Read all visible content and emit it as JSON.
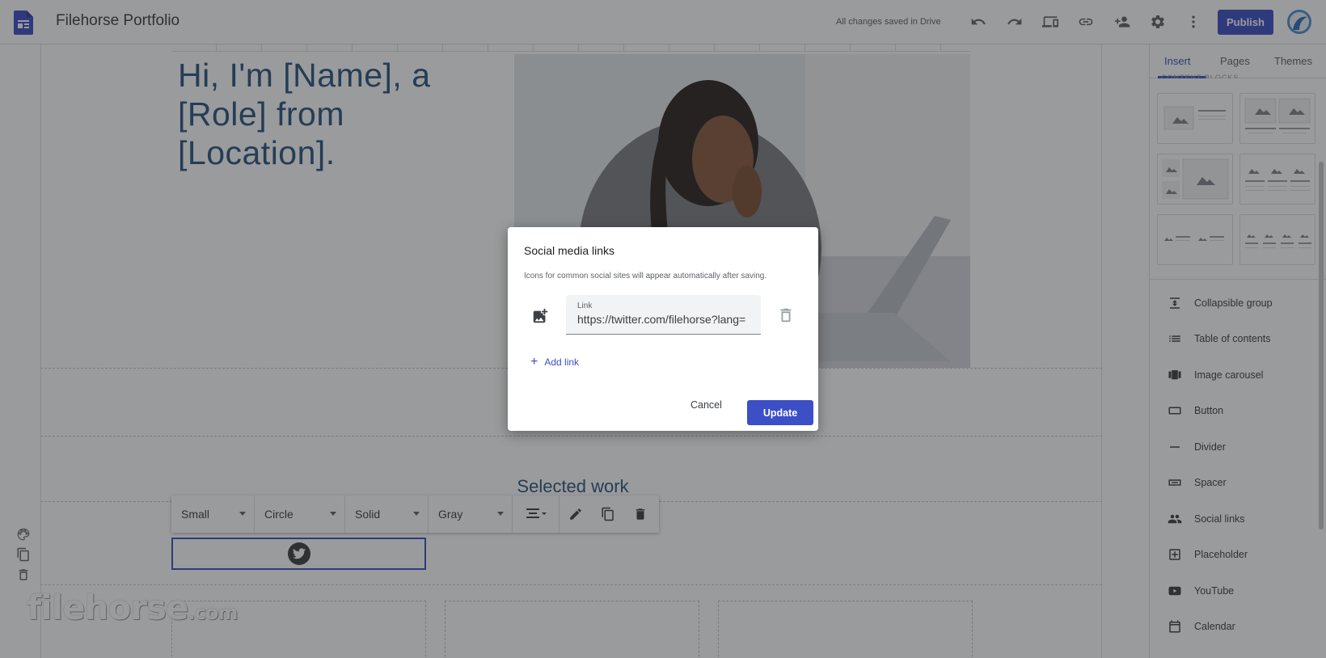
{
  "header": {
    "app_icon": "google-sites-icon",
    "title": "Filehorse Portfolio",
    "save_status": "All changes saved in Drive",
    "toolbar_icons": [
      "undo-icon",
      "redo-icon",
      "preview-icon",
      "link-icon",
      "share-icon",
      "settings-icon",
      "more-vert-icon"
    ],
    "publish_label": "Publish"
  },
  "page": {
    "hero_title": "Hi, I'm [Name], a [Role] from [Location].",
    "section_heading": "Selected work"
  },
  "element_toolbar": {
    "size": "Small",
    "shape": "Circle",
    "style": "Solid",
    "color": "Gray",
    "icons": [
      "align-center-icon",
      "edit-icon",
      "duplicate-icon",
      "delete-icon"
    ]
  },
  "left_tools": [
    "theme-palette-icon",
    "copy-icon",
    "trash-icon"
  ],
  "watermark": {
    "main": "filehorse",
    "suffix": ".com"
  },
  "side_panel": {
    "tabs": [
      "Insert",
      "Pages",
      "Themes"
    ],
    "active_tab": "Insert",
    "blocks_label": "CONTENT BLOCKS",
    "insert_items": [
      {
        "label": "Collapsible group",
        "icon": "collapsible-icon"
      },
      {
        "label": "Table of contents",
        "icon": "toc-icon"
      },
      {
        "label": "Image carousel",
        "icon": "carousel-icon"
      },
      {
        "label": "Button",
        "icon": "button-icon"
      },
      {
        "label": "Divider",
        "icon": "divider-icon"
      },
      {
        "label": "Spacer",
        "icon": "spacer-icon"
      },
      {
        "label": "Social links",
        "icon": "people-icon"
      },
      {
        "label": "Placeholder",
        "icon": "placeholder-icon"
      },
      {
        "label": "YouTube",
        "icon": "youtube-icon"
      },
      {
        "label": "Calendar",
        "icon": "calendar-icon"
      }
    ]
  },
  "dialog": {
    "title": "Social media links",
    "description": "Icons for common social sites will appear automatically after saving.",
    "link_label": "Link",
    "link_value": "https://twitter.com/filehorse?lang=",
    "add_link_label": "Add link",
    "cancel_label": "Cancel",
    "update_label": "Update"
  },
  "colors": {
    "accent": "#3c4fc7",
    "heading": "#2b5480"
  }
}
